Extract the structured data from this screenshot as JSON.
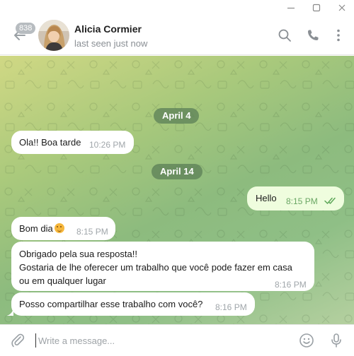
{
  "window": {
    "controls": [
      {
        "name": "minimize",
        "icon": "minimize-icon"
      },
      {
        "name": "maximize",
        "icon": "maximize-icon"
      },
      {
        "name": "close",
        "icon": "close-icon"
      }
    ]
  },
  "header": {
    "unread_count": "838",
    "contact_name": "Alicia Cormier",
    "status": "last seen just now",
    "icons": [
      "back-arrow-icon",
      "search-icon",
      "phone-icon",
      "more-vertical-icon"
    ]
  },
  "chat": {
    "dates": [
      "April 4",
      "April 14"
    ],
    "messages": [
      {
        "direction": "in",
        "text": "Ola!! Boa tarde",
        "time": "10:26 PM"
      },
      {
        "direction": "out",
        "text": "Hello",
        "time": "8:15 PM",
        "read": true
      },
      {
        "direction": "in",
        "text": "Bom dia",
        "emoji": "slightly-smiling-face",
        "time": "8:15 PM"
      },
      {
        "direction": "in",
        "lines": [
          "Obrigado pela sua resposta!!",
          "Gostaria de lhe oferecer um trabalho que você pode fazer em casa",
          "ou em qualquer lugar"
        ],
        "time": "8:16 PM"
      },
      {
        "direction": "in",
        "text": "Posso compartilhar esse trabalho com você?",
        "time": "8:16 PM"
      }
    ]
  },
  "composer": {
    "placeholder": "Write a message...",
    "value": "",
    "icons": [
      "paperclip-icon",
      "emoji-icon",
      "microphone-icon"
    ]
  },
  "colors": {
    "incoming_bubble": "#ffffff",
    "outgoing_bubble": "#effdde",
    "outgoing_time": "#6ba765",
    "date_pill": "#5e8258",
    "accent": "#3a9e45"
  }
}
